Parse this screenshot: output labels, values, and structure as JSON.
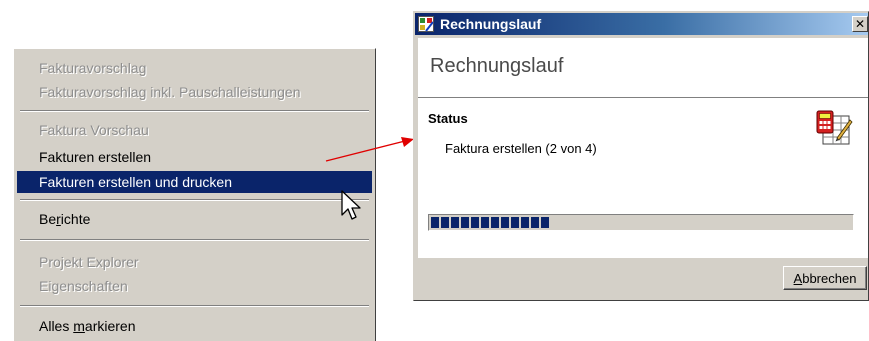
{
  "context_menu": {
    "items": [
      {
        "label": "Fakturavorschlag",
        "state": "disabled"
      },
      {
        "label": "Fakturavorschlag inkl. Pauschalleistungen",
        "state": "disabled"
      },
      {
        "label": "Faktura Vorschau",
        "state": "disabled"
      },
      {
        "label": "Fakturen erstellen",
        "state": "enabled"
      },
      {
        "label": "Fakturen erstellen und drucken",
        "state": "highlighted"
      },
      {
        "label_pre": "Be",
        "label_accel": "r",
        "label_post": "ichte",
        "state": "enabled"
      },
      {
        "label": "Projekt Explorer",
        "state": "disabled"
      },
      {
        "label": "Eigenschaften",
        "state": "disabled"
      },
      {
        "label_pre": "Alles ",
        "label_accel": "m",
        "label_post": "arkieren",
        "state": "enabled"
      }
    ]
  },
  "dialog": {
    "window_title": "Rechnungslauf",
    "heading": "Rechnungslauf",
    "status_label": "Status",
    "status_text": "Faktura erstellen (2 von 4)",
    "progress_fraction": 0.28,
    "cancel_button": {
      "label_accel": "A",
      "label_post": "bbrechen"
    },
    "close_glyph": "✕"
  },
  "colors": {
    "menu_highlight": "#0a246a",
    "title_gradient_start": "#0a246a",
    "title_gradient_end": "#a6caf0",
    "progress_block": "#0a246a",
    "arrow": "#e00000"
  },
  "icons": [
    "app-icon",
    "calculator-form-icon",
    "mouse-cursor-icon",
    "close-icon"
  ]
}
